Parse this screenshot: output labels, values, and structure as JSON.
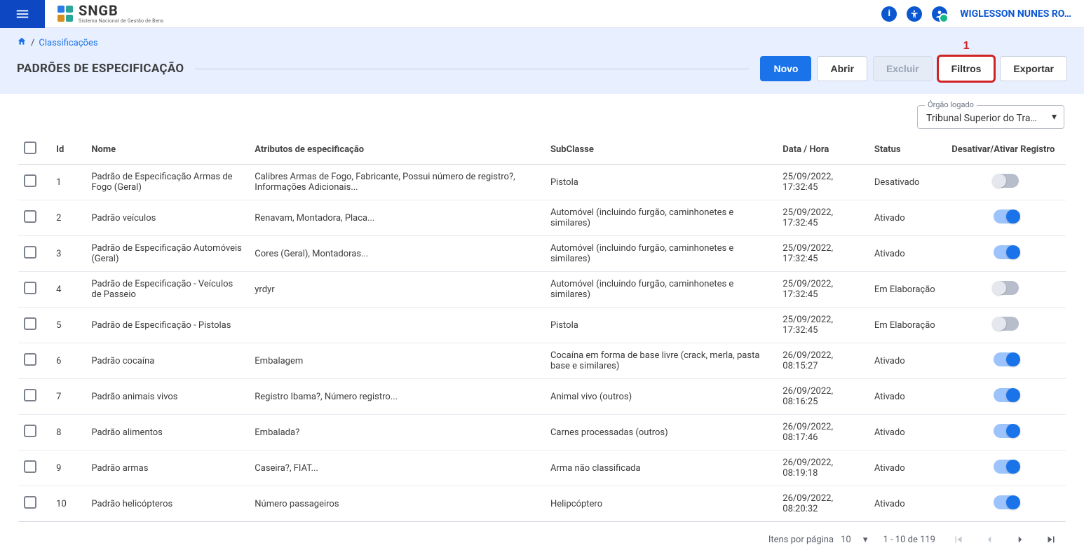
{
  "brand": {
    "name": "SNGB",
    "subtitle": "Sistema Nacional de Gestão de Bens"
  },
  "user": {
    "name": "WIGLESSON NUNES RO…"
  },
  "breadcrumb": {
    "label": "Classificações"
  },
  "page_title": "PADRÕES DE ESPECIFICAÇÃO",
  "toolbar": {
    "novo": "Novo",
    "abrir": "Abrir",
    "excluir": "Excluir",
    "filtros": "Filtros",
    "exportar": "Exportar",
    "filtros_callout": "1"
  },
  "orgao": {
    "label": "Órgão logado",
    "value": "Tribunal Superior do Tra…"
  },
  "columns": {
    "id": "Id",
    "nome": "Nome",
    "atributos": "Atributos de especificação",
    "subclasse": "SubClasse",
    "data": "Data / Hora",
    "status": "Status",
    "toggle": "Desativar/Ativar Registro"
  },
  "rows": [
    {
      "id": "1",
      "nome": "Padrão de Especificação Armas de Fogo (Geral)",
      "atributos": "Calibres Armas de Fogo, Fabricante, Possui número de registro?, Informações Adicionais...",
      "sub": "Pistola",
      "data": "25/09/2022, 17:32:45",
      "status": "Desativado",
      "on": false
    },
    {
      "id": "2",
      "nome": "Padrão veículos",
      "atributos": "Renavam, Montadora, Placa...",
      "sub": "Automóvel (incluindo furgão, caminhonetes e similares)",
      "data": "25/09/2022, 17:32:45",
      "status": "Ativado",
      "on": true
    },
    {
      "id": "3",
      "nome": "Padrão de Especificação Automóveis (Geral)",
      "atributos": "Cores (Geral), Montadoras...",
      "sub": "Automóvel (incluindo furgão, caminhonetes e similares)",
      "data": "25/09/2022, 17:32:45",
      "status": "Ativado",
      "on": true
    },
    {
      "id": "4",
      "nome": "Padrão de Especificação - Veículos de Passeio",
      "atributos": "yrdyr",
      "sub": "Automóvel (incluindo furgão, caminhonetes e similares)",
      "data": "25/09/2022, 17:32:45",
      "status": "Em Elaboração",
      "on": false
    },
    {
      "id": "5",
      "nome": "Padrão de Especificação - Pistolas",
      "atributos": "",
      "sub": "Pistola",
      "data": "25/09/2022, 17:32:45",
      "status": "Em Elaboração",
      "on": false
    },
    {
      "id": "6",
      "nome": "Padrão cocaína",
      "atributos": "Embalagem",
      "sub": "Cocaína em forma de base livre (crack, merla, pasta base e similares)",
      "data": "26/09/2022, 08:15:27",
      "status": "Ativado",
      "on": true
    },
    {
      "id": "7",
      "nome": "Padrão animais vivos",
      "atributos": "Registro Ibama?, Número registro...",
      "sub": "Animal vivo (outros)",
      "data": "26/09/2022, 08:16:25",
      "status": "Ativado",
      "on": true
    },
    {
      "id": "8",
      "nome": "Padrão alimentos",
      "atributos": "Embalada?",
      "sub": "Carnes processadas (outros)",
      "data": "26/09/2022, 08:17:46",
      "status": "Ativado",
      "on": true
    },
    {
      "id": "9",
      "nome": "Padrão armas",
      "atributos": "Caseira?, FIAT...",
      "sub": "Arma não classificada",
      "data": "26/09/2022, 08:19:18",
      "status": "Ativado",
      "on": true
    },
    {
      "id": "10",
      "nome": "Padrão helicópteros",
      "atributos": "Número passageiros",
      "sub": "Helipcóptero",
      "data": "26/09/2022, 08:20:32",
      "status": "Ativado",
      "on": true
    }
  ],
  "pager": {
    "per_page_label": "Itens por página",
    "per_page_value": "10",
    "range": "1 - 10 de 119"
  }
}
